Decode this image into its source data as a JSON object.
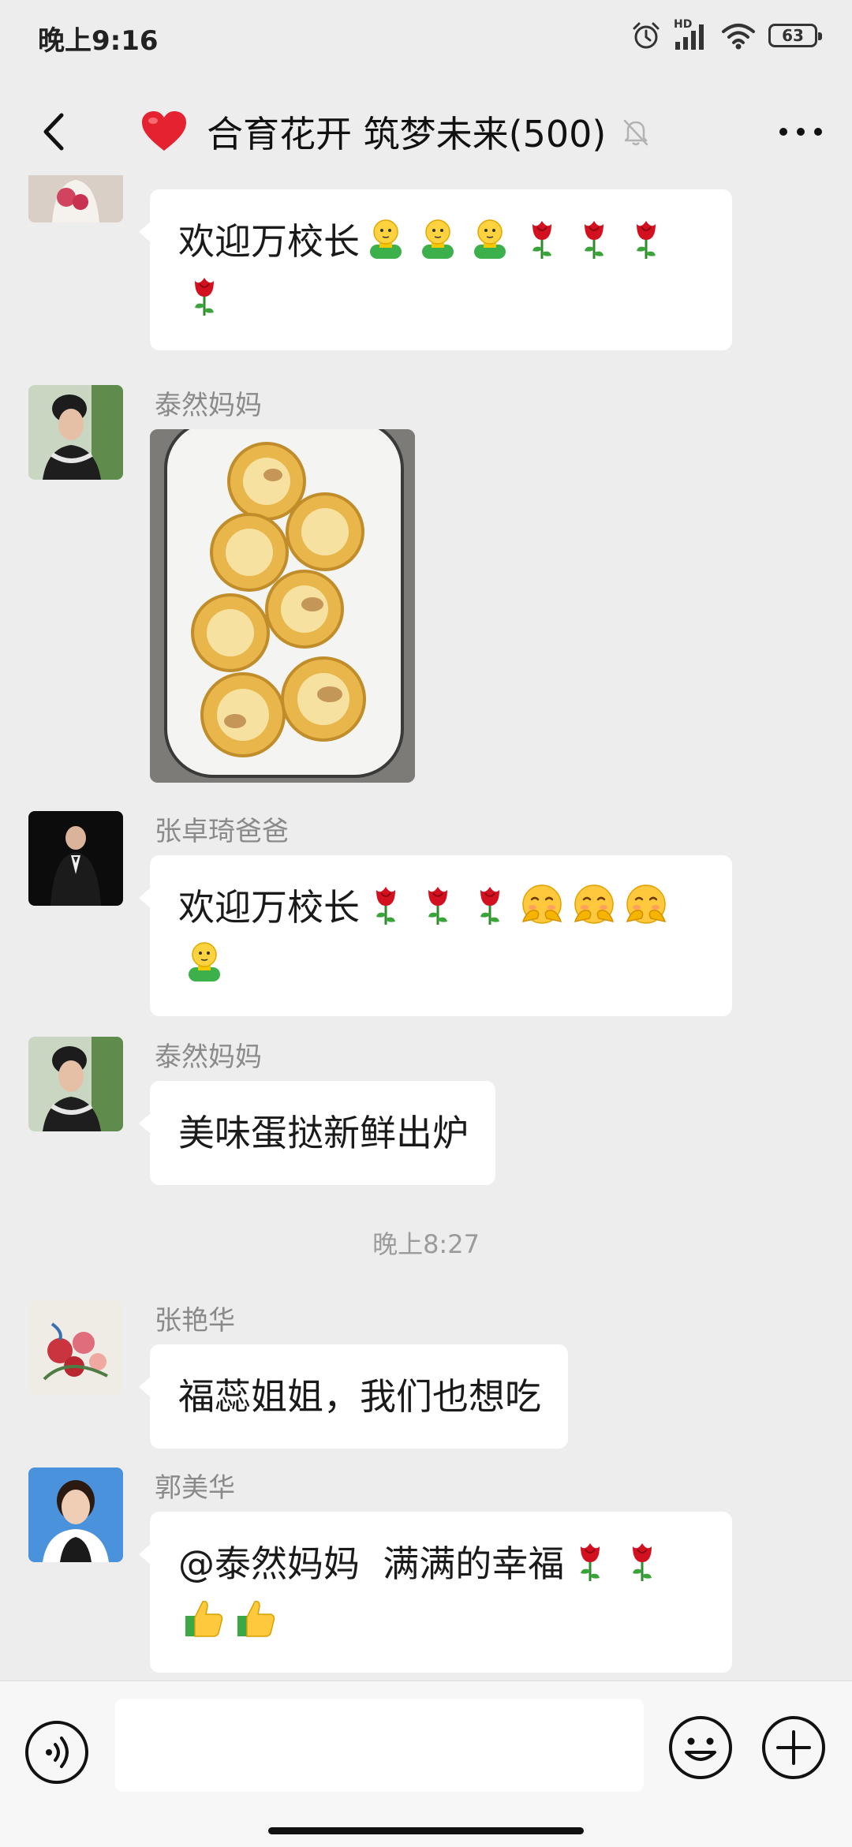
{
  "status_bar": {
    "time": "晚上9:16",
    "network": "HD",
    "battery": "63",
    "icons": [
      "alarm-icon",
      "signal-icon",
      "wifi-icon",
      "battery-icon"
    ]
  },
  "header": {
    "title": "合育花开 筑梦未来(500)",
    "title_icon": "red-heart-icon",
    "icons": [
      "back-icon",
      "mute-bell-icon",
      "more-icon"
    ]
  },
  "messages": [
    {
      "sender": "",
      "type": "text",
      "text": "欢迎万校长",
      "emojis": [
        "smiley-guy",
        "smiley-guy",
        "smiley-guy",
        "rose",
        "rose",
        "rose",
        "rose"
      ]
    },
    {
      "sender": "泰然妈妈",
      "type": "image",
      "image_desc": "egg-tarts-on-plate"
    },
    {
      "sender": "张卓琦爸爸",
      "type": "text",
      "text": "欢迎万校长",
      "emojis": [
        "rose",
        "rose",
        "rose",
        "shy-hug",
        "shy-hug",
        "shy-hug",
        "smiley-guy"
      ]
    },
    {
      "sender": "泰然妈妈",
      "type": "text",
      "text": "美味蛋挞新鲜出炉",
      "emojis": []
    },
    {
      "sender": "张艳华",
      "type": "text",
      "text": "福蕊姐姐，我们也想吃",
      "emojis": []
    },
    {
      "sender": "郭美华",
      "type": "text",
      "text": "@泰然妈妈  满满的幸福",
      "emojis": [
        "rose",
        "rose",
        "thumbs-up",
        "thumbs-up"
      ]
    }
  ],
  "time_separator": "晚上8:27",
  "input_bar": {
    "placeholder": "",
    "icons": [
      "voice-icon",
      "emoji-icon",
      "plus-icon"
    ]
  },
  "colors": {
    "background": "#ededed",
    "bubble": "#ffffff",
    "sender_name": "#8a8a8a",
    "heart": "#e5222f"
  }
}
